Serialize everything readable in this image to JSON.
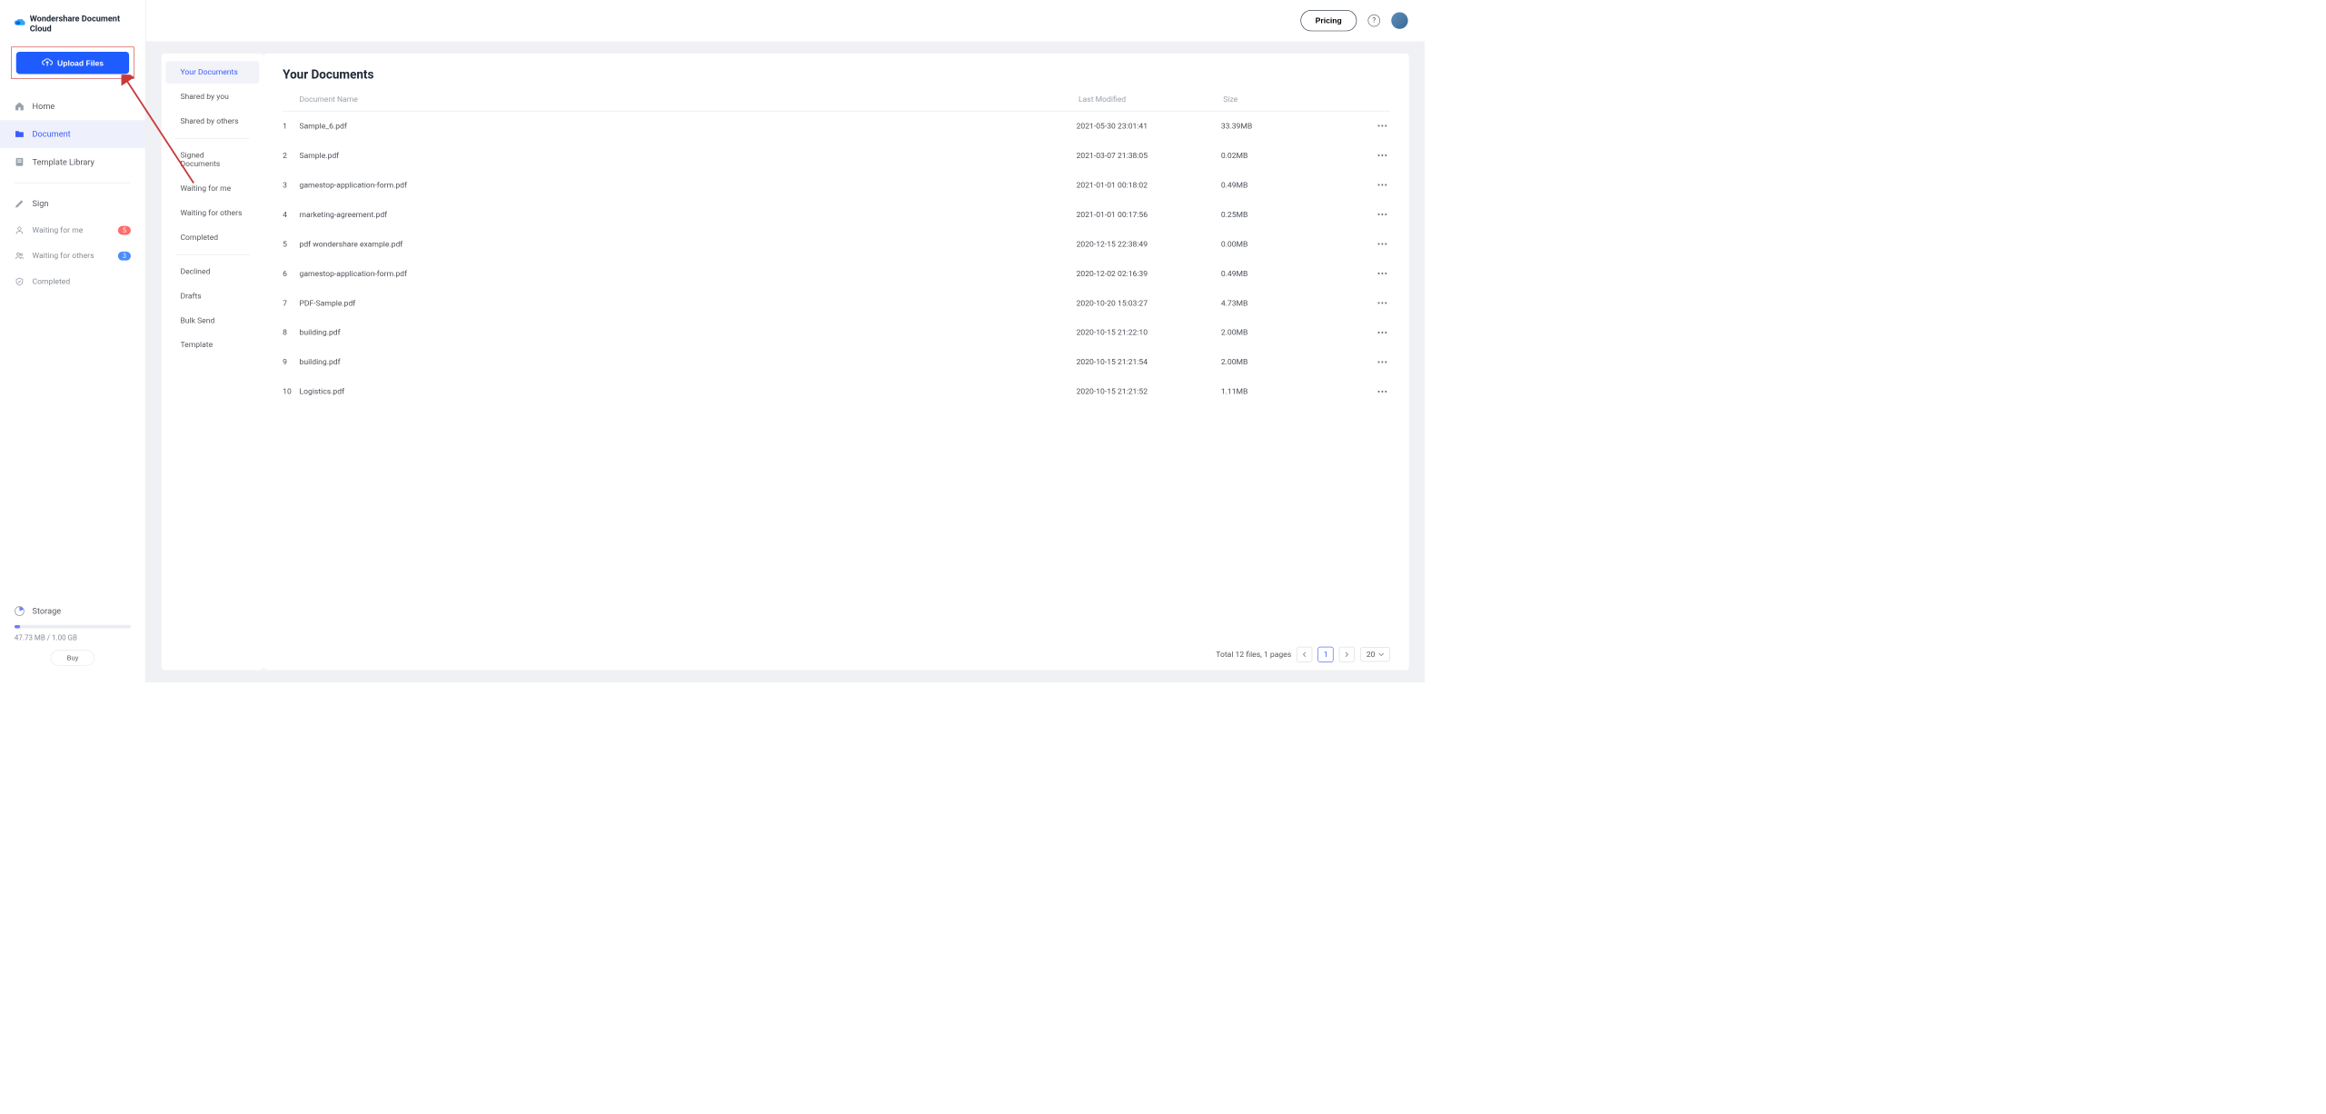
{
  "brand": "Wondershare Document Cloud",
  "upload_label": "Upload Files",
  "sidebar": {
    "items": [
      {
        "label": "Home"
      },
      {
        "label": "Document"
      },
      {
        "label": "Template Library"
      },
      {
        "label": "Sign"
      },
      {
        "label": "Waiting for me",
        "badge": "5"
      },
      {
        "label": "Waiting for others",
        "badge": "3"
      },
      {
        "label": "Completed"
      }
    ]
  },
  "storage": {
    "label": "Storage",
    "text": "47.73 MB / 1.00 GB",
    "buy": "Buy"
  },
  "topbar": {
    "pricing": "Pricing"
  },
  "subnav": {
    "items": [
      {
        "label": "Your Documents"
      },
      {
        "label": "Shared by you"
      },
      {
        "label": "Shared by others"
      },
      {
        "label": "Signed Documents"
      },
      {
        "label": "Waiting for me"
      },
      {
        "label": "Waiting for others"
      },
      {
        "label": "Completed"
      },
      {
        "label": "Declined"
      },
      {
        "label": "Drafts"
      },
      {
        "label": "Bulk Send"
      },
      {
        "label": "Template"
      }
    ]
  },
  "main": {
    "title": "Your Documents",
    "columns": {
      "name": "Document Name",
      "modified": "Last Modified",
      "size": "Size"
    },
    "rows": [
      {
        "idx": "1",
        "name": "Sample_6.pdf",
        "modified": "2021-05-30 23:01:41",
        "size": "33.39MB"
      },
      {
        "idx": "2",
        "name": "Sample.pdf",
        "modified": "2021-03-07 21:38:05",
        "size": "0.02MB"
      },
      {
        "idx": "3",
        "name": "gamestop-application-form.pdf",
        "modified": "2021-01-01 00:18:02",
        "size": "0.49MB"
      },
      {
        "idx": "4",
        "name": "marketing-agreement.pdf",
        "modified": "2021-01-01 00:17:56",
        "size": "0.25MB"
      },
      {
        "idx": "5",
        "name": "pdf wondershare example.pdf",
        "modified": "2020-12-15 22:38:49",
        "size": "0.00MB"
      },
      {
        "idx": "6",
        "name": "gamestop-application-form.pdf",
        "modified": "2020-12-02 02:16:39",
        "size": "0.49MB"
      },
      {
        "idx": "7",
        "name": "PDF-Sample.pdf",
        "modified": "2020-10-20 15:03:27",
        "size": "4.73MB"
      },
      {
        "idx": "8",
        "name": "building.pdf",
        "modified": "2020-10-15 21:22:10",
        "size": "2.00MB"
      },
      {
        "idx": "9",
        "name": "building.pdf",
        "modified": "2020-10-15 21:21:54",
        "size": "2.00MB"
      },
      {
        "idx": "10",
        "name": "Logistics.pdf",
        "modified": "2020-10-15 21:21:52",
        "size": "1.11MB"
      }
    ],
    "pager": {
      "summary": "Total 12 files, 1 pages",
      "current": "1",
      "page_size": "20"
    }
  }
}
